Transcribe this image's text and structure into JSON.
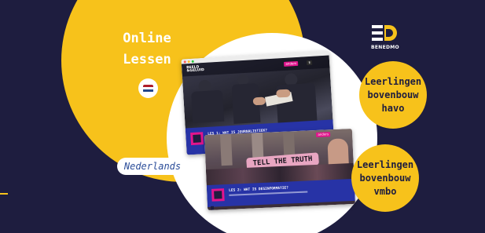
{
  "banner": {
    "title_line1": "Online",
    "title_line2": "Lessen",
    "language_label": "Nederlands",
    "flag_icon": "netherlands-flag-icon",
    "flag_colors": [
      "#ae1c28",
      "#ffffff",
      "#21468b"
    ]
  },
  "brand": {
    "logo_icon": "benedmo-logo-icon",
    "name": "BENEDMO"
  },
  "badges": [
    {
      "line1": "Leerlingen",
      "line2": "bovenbouw",
      "line3": "havo"
    },
    {
      "line1": "Leerlingen",
      "line2": "bovenbouw",
      "line3": "vmbo"
    }
  ],
  "screens": [
    {
      "site_logo_line1": "BEELD",
      "site_logo_line2": "&GELUID",
      "pill_1": "anders",
      "lesson_title": "LES 1: WAT IS JOURNALISTIEK?"
    },
    {
      "pill_1": "anders",
      "sign_text": "TELL THE TRUTH",
      "lesson_title": "LES 2: WAT IS DESINFORMATIE?"
    }
  ],
  "colors": {
    "background": "#1e1d3f",
    "accent_yellow": "#f7c21b",
    "magenta": "#e2158d",
    "lesson_blue": "#2733a6"
  }
}
